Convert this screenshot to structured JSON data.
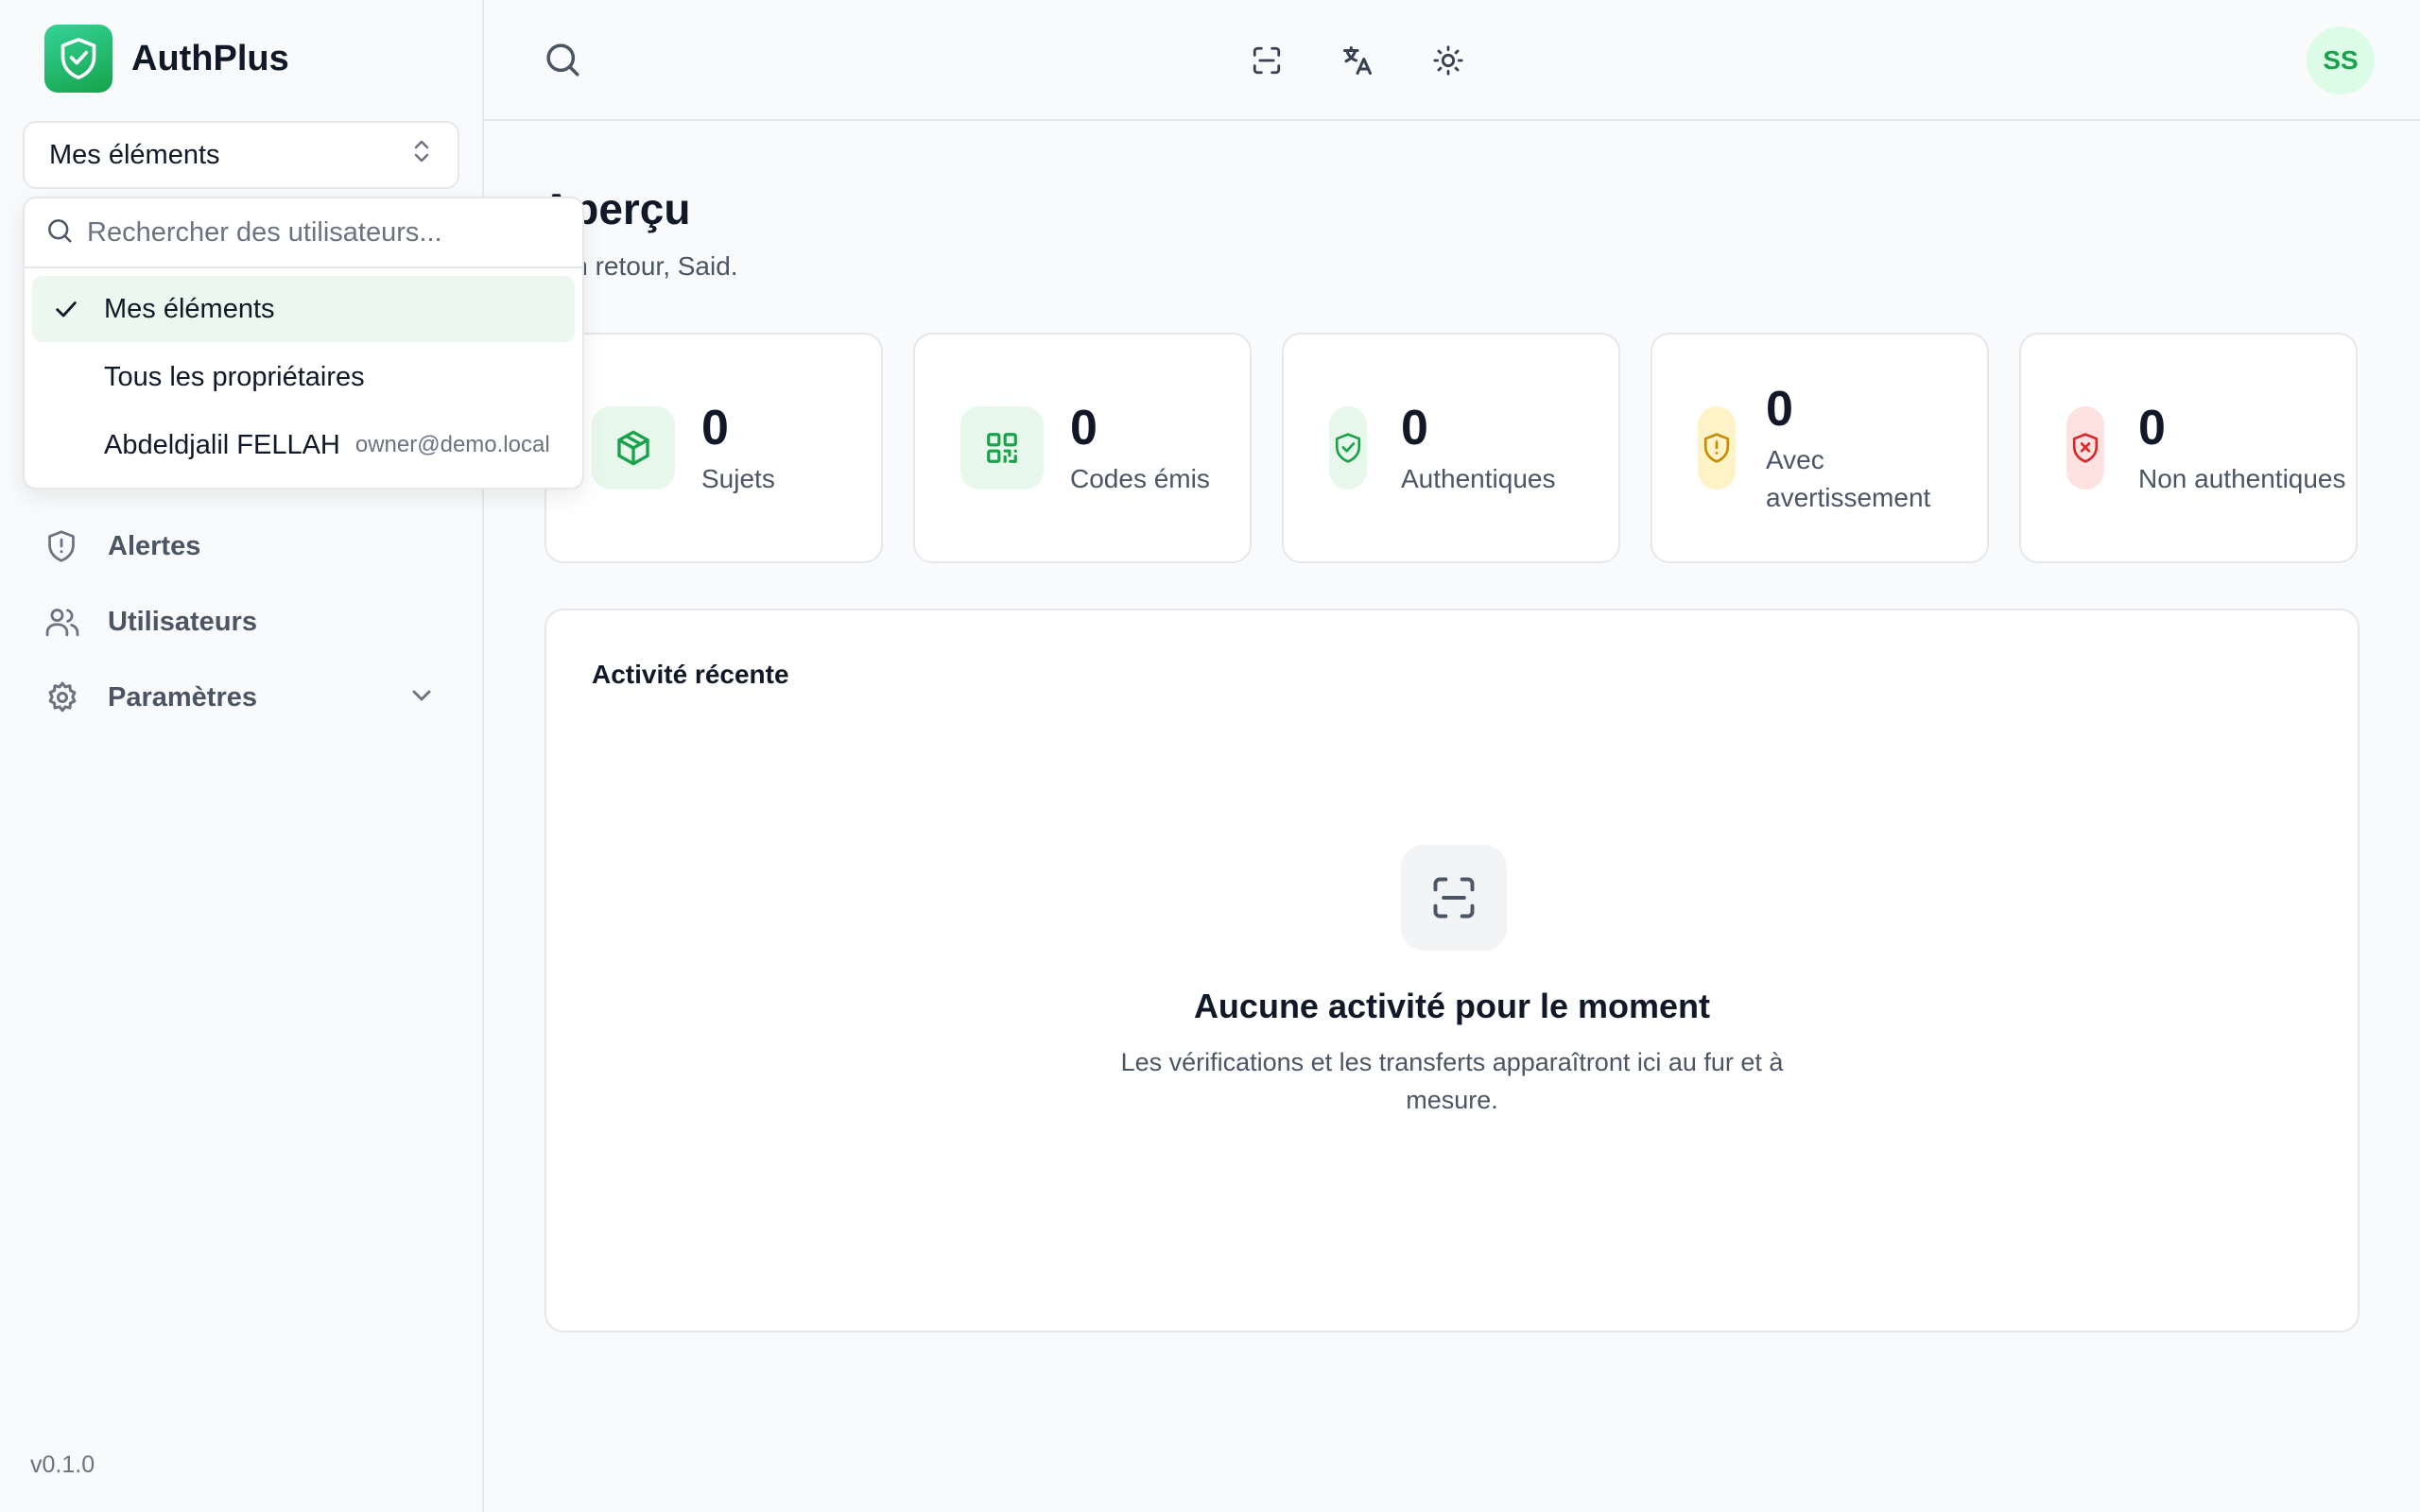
{
  "app": {
    "name": "AuthPlus",
    "version": "v0.1.0"
  },
  "colors": {
    "accent": "#16a34a",
    "warning": "#eab308",
    "danger": "#dc2626"
  },
  "owner_filter": {
    "selected": "Mes éléments",
    "search_placeholder": "Rechercher des utilisateurs...",
    "options": [
      {
        "label": "Mes éléments",
        "email": "",
        "selected": true
      },
      {
        "label": "Tous les propriétaires",
        "email": "",
        "selected": false
      },
      {
        "label": "Abdeldjalil FELLAH",
        "email": "owner@demo.local",
        "selected": false
      }
    ]
  },
  "nav": {
    "items": [
      {
        "label": "Alertes",
        "icon": "shield-alert-icon"
      },
      {
        "label": "Utilisateurs",
        "icon": "users-icon"
      },
      {
        "label": "Paramètres",
        "icon": "gear-icon",
        "expandable": true
      }
    ]
  },
  "topbar": {
    "icons": [
      "search-icon",
      "scan-icon",
      "translate-icon",
      "sun-icon"
    ],
    "avatar_initials": "SS"
  },
  "page": {
    "title": "Aperçu",
    "subtitle": "Bon retour, Said."
  },
  "stats": [
    {
      "value": "0",
      "label": "Sujets",
      "icon": "package-icon"
    },
    {
      "value": "0",
      "label": "Codes émis",
      "icon": "qr-code-icon"
    },
    {
      "value": "0",
      "label": "Authentiques",
      "icon": "shield-check-icon"
    },
    {
      "value": "0",
      "label": "Avec avertissement",
      "icon": "shield-warning-icon"
    },
    {
      "value": "0",
      "label": "Non authentiques",
      "icon": "shield-x-icon"
    }
  ],
  "activity": {
    "title": "Activité récente",
    "empty_title": "Aucune activité pour le moment",
    "empty_description": "Les vérifications et les transferts apparaîtront ici au fur et à mesure."
  }
}
